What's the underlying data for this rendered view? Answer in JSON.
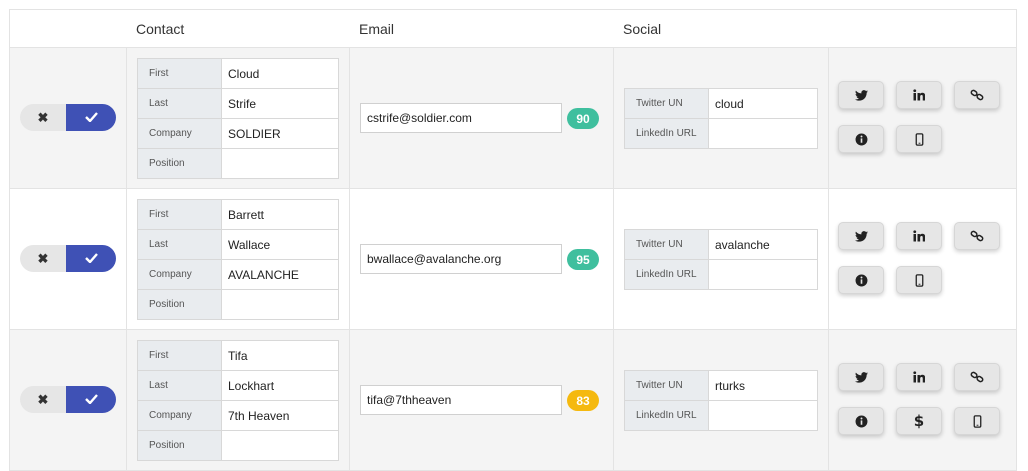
{
  "header": {
    "contact": "Contact",
    "email": "Email",
    "social": "Social"
  },
  "colors": {
    "accent": "#3f51b5",
    "badge_green": "#3fbf9e",
    "badge_yellow": "#f5b90f"
  },
  "contacts": [
    {
      "labels": {
        "first": "First",
        "last": "Last",
        "company": "Company",
        "position": "Position"
      },
      "first": "Cloud",
      "last": "Strife",
      "company": "SOLDIER",
      "position": "",
      "email": "cstrife@soldier.com",
      "score": "90",
      "score_color": "green",
      "social_labels": {
        "twitter": "Twitter UN",
        "linkedin": "LinkedIn URL"
      },
      "twitter": "cloud",
      "linkedin": "",
      "actions": [
        "twitter-icon",
        "linkedin-icon",
        "link-icon",
        "info-icon",
        "mobile-icon"
      ]
    },
    {
      "labels": {
        "first": "First",
        "last": "Last",
        "company": "Company",
        "position": "Position"
      },
      "first": "Barrett",
      "last": "Wallace",
      "company": "AVALANCHE",
      "position": "",
      "email": "bwallace@avalanche.org",
      "score": "95",
      "score_color": "green",
      "social_labels": {
        "twitter": "Twitter UN",
        "linkedin": "LinkedIn URL"
      },
      "twitter": "avalanche",
      "linkedin": "",
      "actions": [
        "twitter-icon",
        "linkedin-icon",
        "link-icon",
        "info-icon",
        "mobile-icon"
      ]
    },
    {
      "labels": {
        "first": "First",
        "last": "Last",
        "company": "Company",
        "position": "Position"
      },
      "first": "Tifa",
      "last": "Lockhart",
      "company": "7th Heaven",
      "position": "",
      "email": "tifa@7thheaven",
      "score": "83",
      "score_color": "yellow",
      "social_labels": {
        "twitter": "Twitter UN",
        "linkedin": "LinkedIn URL"
      },
      "twitter": "rturks",
      "linkedin": "",
      "actions": [
        "twitter-icon",
        "linkedin-icon",
        "link-icon",
        "info-icon",
        "dollar-icon",
        "mobile-icon"
      ]
    }
  ]
}
